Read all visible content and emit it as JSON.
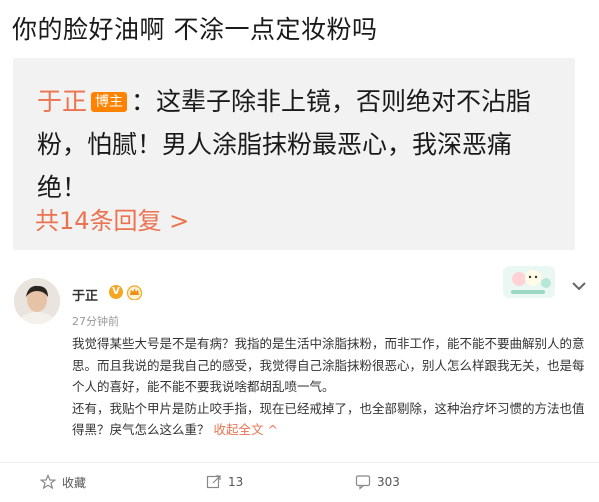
{
  "top_comment": {
    "text": "你的脸好油啊 不涂一点定妆粉吗"
  },
  "reply_box": {
    "username": "于正",
    "badge": "博主",
    "text": "：这辈子除非上镜，否则绝对不沾脂粉，怕腻！男人涂脂抹粉最恶心，我深恶痛绝！",
    "more_replies": "共14条回复 >"
  },
  "post": {
    "username": "于正",
    "timestamp": "27分钟前",
    "paragraph1": "我觉得某些大号是不是有病？我指的是生活中涂脂抹粉，而非工作，能不能不要曲解别人的意思。而且我说的是我自己的感受，我觉得自己涂脂抹粉很恶心，别人怎么样跟我无关，也是每个人的喜好，能不能不要我说啥都胡乱喷一气。",
    "paragraph2": "还有，我贴个甲片是防止咬手指，现在已经戒掉了，也全部剔除，这种治疗坏习惯的方法也值得黑？戾气怎么这么重？",
    "collapse_label": "收起全文 ^"
  },
  "actions": {
    "favorite_label": "收藏",
    "repost_count": "13",
    "comment_count": "303"
  },
  "colors": {
    "accent": "#eb7350",
    "badge_orange": "#ff8200",
    "reply_bg": "#f2f2f2"
  },
  "icons": [
    "v-verified-icon",
    "crown-badge-icon",
    "sticker-icon",
    "chevron-down-icon",
    "star-icon",
    "repost-icon",
    "comment-icon"
  ]
}
